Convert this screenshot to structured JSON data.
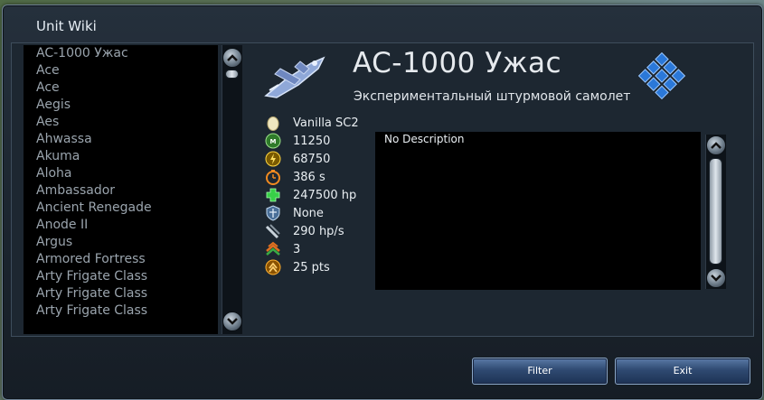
{
  "window": {
    "title": "Unit Wiki"
  },
  "unit_list": {
    "items": [
      "AC-1000 Ужас",
      "Ace",
      "Ace",
      "Aegis",
      "Aes",
      "Ahwassa",
      "Akuma",
      "Aloha",
      "Ambassador",
      "Ancient Renegade",
      "Anode II",
      "Argus",
      "Armored Fortress",
      "Arty Frigate Class",
      "Arty Frigate Class",
      "Arty Frigate Class"
    ]
  },
  "unit": {
    "name": "AC-1000 Ужас",
    "subtitle": "Экспериментальный штурмовой самолет",
    "stats": [
      {
        "icon": "egg-icon",
        "value": "Vanilla SC2",
        "color": "#e8e0b8"
      },
      {
        "icon": "metal-icon",
        "value": "11250",
        "color": "#55b84a"
      },
      {
        "icon": "energy-icon",
        "value": "68750",
        "color": "#f0b400"
      },
      {
        "icon": "time-icon",
        "value": "386 s",
        "color": "#e08020"
      },
      {
        "icon": "health-icon",
        "value": "247500 hp",
        "color": "#33cc44"
      },
      {
        "icon": "shield-icon",
        "value": "None",
        "color": "#8ab0d8"
      },
      {
        "icon": "repair-icon",
        "value": "290 hp/s",
        "color": "#b8c4cc"
      },
      {
        "icon": "rank-icon",
        "value": "3",
        "color": "#e06020"
      },
      {
        "icon": "points-icon",
        "value": "25 pts",
        "color": "#f0a000"
      }
    ],
    "description": "No Description"
  },
  "buttons": {
    "filter": "Filter",
    "exit": "Exit"
  },
  "colors": {
    "accent": "#2f6fd0",
    "window_bg": "#1b242e",
    "list_text": "#9aa4ad"
  }
}
